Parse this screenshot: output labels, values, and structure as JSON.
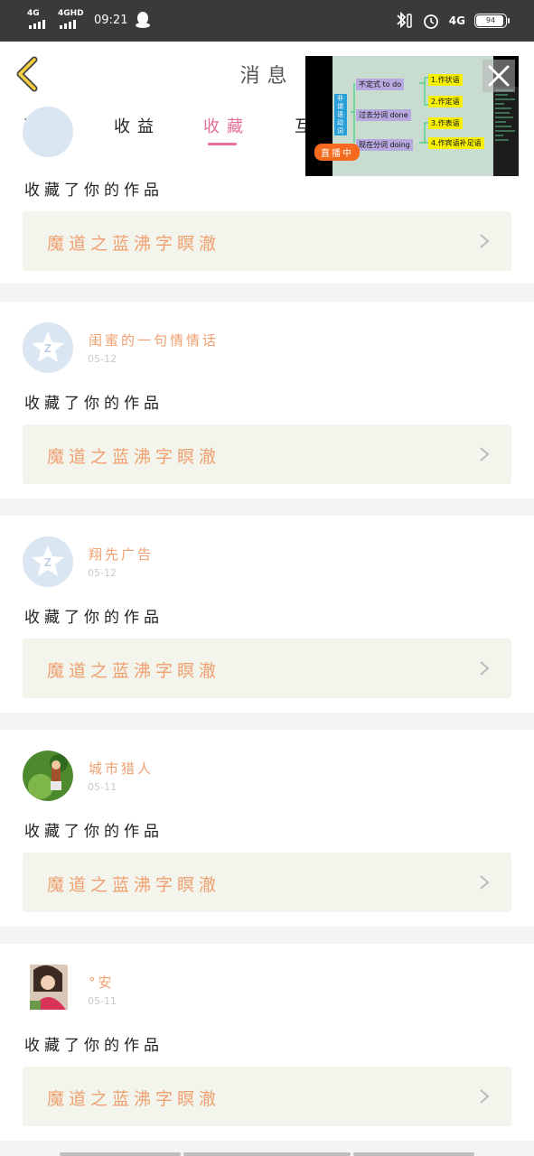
{
  "status_bar": {
    "network1": "4G",
    "network2": "4GHD",
    "time": "09:21",
    "network3": "4G",
    "battery": "94"
  },
  "header": {
    "title": "消息"
  },
  "tabs": [
    {
      "label": "通知"
    },
    {
      "label": "收益"
    },
    {
      "label": "收藏"
    },
    {
      "label": "互"
    }
  ],
  "video_overlay": {
    "live_label": "直播中",
    "slide_nodes": {
      "left": "非谓语动词",
      "a": "不定式 to do",
      "b": "过去分词 done",
      "c": "现在分词 doing",
      "r1": "1.作状语",
      "r2": "2.作定语",
      "r3": "3.作表语",
      "r4": "4.作宾语补足语"
    }
  },
  "feed": [
    {
      "name": "",
      "date": "",
      "action": "收藏了你的作品",
      "work_title": "魔道之蓝沸字瞑澈",
      "avatar": "default"
    },
    {
      "name": "闺蜜的一句情情话",
      "date": "05-12",
      "action": "收藏了你的作品",
      "work_title": "魔道之蓝沸字瞑澈",
      "avatar": "default"
    },
    {
      "name": "翔先广告",
      "date": "05-12",
      "action": "收藏了你的作品",
      "work_title": "魔道之蓝沸字瞑澈",
      "avatar": "default"
    },
    {
      "name": "城市猎人",
      "date": "05-11",
      "action": "收藏了你的作品",
      "work_title": "魔道之蓝沸字瞑澈",
      "avatar": "photo-grass"
    },
    {
      "name": "°安",
      "date": "05-11",
      "action": "收藏了你的作品",
      "work_title": "魔道之蓝沸字瞑澈",
      "avatar": "photo-girl"
    }
  ],
  "colors": {
    "accent": "#e56f9a",
    "name_orange": "#f0a070",
    "work_bg": "#f3f4ec"
  }
}
